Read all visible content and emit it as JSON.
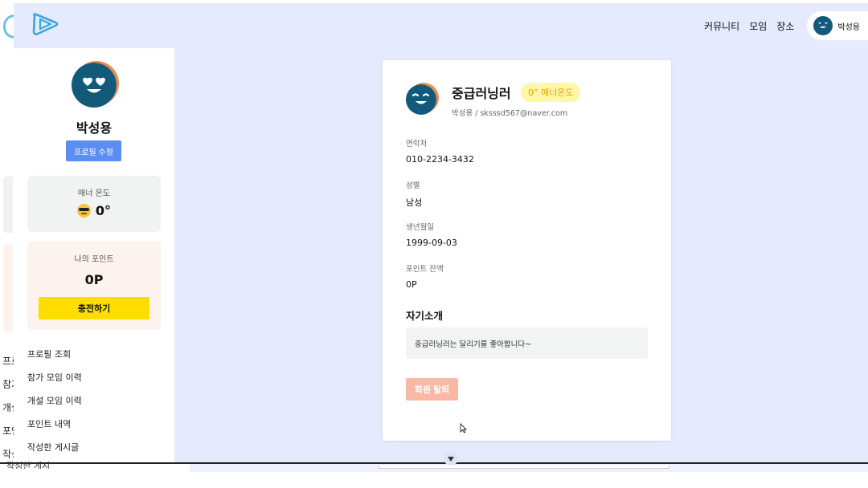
{
  "header": {
    "nav": [
      "커뮤니티",
      "모임",
      "장소"
    ],
    "user_name": "박성용"
  },
  "sidebar": {
    "user_name": "박성용",
    "edit_label": "프로필 수정",
    "manner": {
      "label": "매너 온도",
      "value": "0°"
    },
    "points": {
      "label": "나의 포인트",
      "value": "0P",
      "charge_label": "충전하기"
    },
    "menu": [
      "프로필 조회",
      "참가 모임 이력",
      "개설 모임 이력",
      "포인트 내역",
      "작성한 게시글"
    ]
  },
  "profile": {
    "nickname": "중급러닝러",
    "temp_badge": "0° 매너온도",
    "subline": "박성용 / sksssd567@naver.com",
    "fields": [
      {
        "label": "연락처",
        "value": "010-2234-3432"
      },
      {
        "label": "성별",
        "value": "남성"
      },
      {
        "label": "생년월일",
        "value": "1999-09-03"
      },
      {
        "label": "포인트 잔액",
        "value": "0P"
      }
    ],
    "intro_title": "자기소개",
    "intro_text": "중급러닝러는 달리기를 좋아합니다~",
    "withdraw_label": "회원 탈퇴"
  },
  "ghost": {
    "menu": [
      "프로",
      "참가",
      "개설",
      "포인",
      "작성"
    ],
    "bottom_text": "작성한 게시글"
  },
  "colors": {
    "header_bg": "#e6eaff",
    "primary_blue": "#5b8ef5",
    "charge_yellow": "#ffdd00",
    "withdraw_salmon": "#f9b8a4",
    "avatar_navy": "#135a7a",
    "avatar_rim": "#f08a4b"
  },
  "icons": [
    "logo-icon",
    "avatar-face-icon",
    "sunglasses-emoji-icon",
    "scroll-down-icon",
    "mouse-cursor-icon"
  ]
}
